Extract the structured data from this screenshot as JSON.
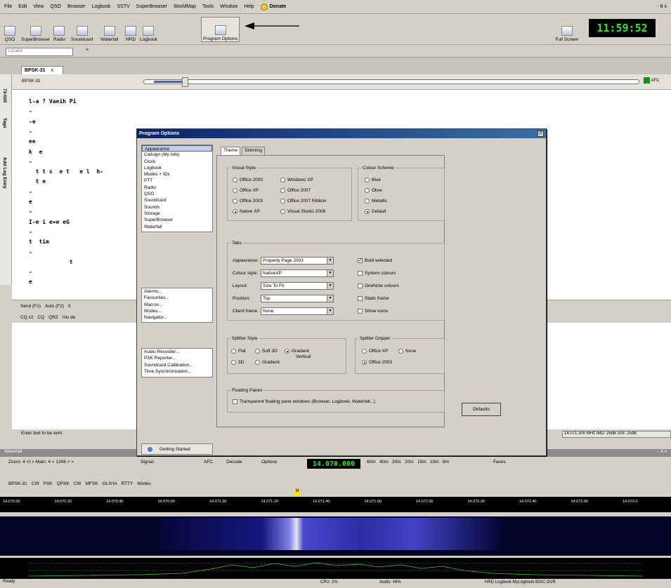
{
  "menubar": {
    "items": [
      "File",
      "Edit",
      "View",
      "QSO",
      "Browser",
      "Logbook",
      "SSTV",
      "SuperBrowser",
      "WorldMap",
      "Tools",
      "Window",
      "Help"
    ],
    "donate": "Donate",
    "window_controls": "- 8 x"
  },
  "toolbar": {
    "buttons": [
      "QSO",
      "SuperBrowser",
      "Radio",
      "Soundcard",
      "Waterfall",
      "HRD",
      "Logbook",
      "Program Options"
    ],
    "fullscreen": "Full Screen",
    "clock": "11:59:52"
  },
  "locator": {
    "placeholder": "Locator",
    "arrow": ">"
  },
  "doc_tab": {
    "label": "BPSK-31",
    "close": "x"
  },
  "side_tabs": [
    "73-020",
    "Tags",
    "Add Log Entry"
  ],
  "inner_toolbar": {
    "mode": "BPSK-31",
    "afc": "AFC"
  },
  "rx_lines": [
    "l-a ? Vaeih Pi",
    "-",
    "-e",
    "-",
    "ee",
    "k  e",
    "-",
    "  t t s  e t   e l  h-",
    "  t e",
    "-",
    "e",
    "-",
    "I-e i e=e eG",
    "-",
    "t  tim",
    "-",
    "            t",
    "-",
    "e"
  ],
  "tx": {
    "buttons": [
      "Send (F1)",
      "Auto (F2)",
      "II"
    ],
    "macros": [
      "CQ x2",
      "CQ",
      "QRZ",
      "His de"
    ],
    "hint": "Enter text to be sent",
    "freq_info": "14.071.300 MHz IMD: 26dB S/N: 25dB"
  },
  "dialog": {
    "title": "Program Options",
    "close": "X",
    "nav_group1": [
      "Appearance",
      "Callsign (My Info)",
      "Clock",
      "Logbook",
      "Modes + IDs",
      "PTT",
      "Radio",
      "QSO",
      "Soundcard",
      "Sounds",
      "Storage",
      "SuperBrowser",
      "Waterfall"
    ],
    "nav_group2": [
      "Alarms...",
      "Favourites...",
      "Macros...",
      "Modes...",
      "Navigator..."
    ],
    "nav_group3": [
      "Audio Recorder...",
      "PSK Reporter...",
      "Soundcard Calibration...",
      "Time Synchronisation..."
    ],
    "getting_started": "Getting Started",
    "tabs": [
      "Theme",
      "Skinning"
    ],
    "visual_style": {
      "legend": "Visual Style",
      "options": [
        "Office 2000",
        "Windows XP",
        "Office XP",
        "Office 2007",
        "Office 2003",
        "Office 2007 Ribbon",
        "Native XP",
        "Visual Studio 2008"
      ],
      "selected": "Native XP"
    },
    "colour_scheme": {
      "legend": "Colour Scheme",
      "options": [
        "Blue",
        "Olive",
        "Metallic",
        "Default"
      ],
      "selected": "Default"
    },
    "tabs_group": {
      "legend": "Tabs",
      "appearance_label": "Appearance:",
      "appearance_value": "Property Page 2003",
      "colour_style_label": "Colour style:",
      "colour_style_value": "NativeXP",
      "layout_label": "Layout:",
      "layout_value": "Size To Fit",
      "position_label": "Position:",
      "position_value": "Top",
      "client_frame_label": "Client frame:",
      "client_frame_value": "None",
      "checks": [
        "Bold selected",
        "System colours",
        "OneNote colours",
        "Static frame",
        "Show icons"
      ],
      "checked": [
        "Bold selected"
      ]
    },
    "splitter_style": {
      "legend": "Splitter Style",
      "options": [
        "Flat",
        "Soft 3D",
        "Gradient",
        "3D",
        "Gradient",
        "Vertical"
      ],
      "selected": "Gradient"
    },
    "splitter_gripper": {
      "legend": "Splitter Gripper",
      "options": [
        "Office XP",
        "None",
        "Office 2003"
      ],
      "selected": "Office 2003"
    },
    "floating_panes": {
      "legend": "Floating Panes",
      "check": "Transparent floating pane windows (Browser, Logbook, Waterfall...)"
    },
    "defaults_button": "Defaults"
  },
  "waterfall": {
    "header": "Waterfall",
    "header_controls": "- 4 x",
    "zoom": "Zoom: 4 <I > Main: 4 < 1306 > >",
    "signal": "Signal:",
    "afc": "AFC",
    "decode": "Decode",
    "options": "Options",
    "frequency": "14.070.000",
    "bands": [
      "80m",
      "40m",
      "30m",
      "20m",
      "15m",
      "10m",
      "6m"
    ],
    "faves": "Faves",
    "modes": [
      "BPSK-31",
      "CW",
      "PSK",
      "QPSK",
      "CW",
      "MFSK",
      "OLIVIA",
      "RTTY",
      "Modes"
    ],
    "scale": [
      "14.070.00",
      "14.070.20",
      "14.070.40",
      "14.070.60",
      "14.071.00",
      "14.071.20",
      "14.071.40",
      "14.071.60",
      "14.072.00",
      "14.072.20",
      "14.072.40",
      "14.072.60",
      "14.073.0"
    ],
    "marker": "M"
  },
  "status": {
    "ready": "Ready",
    "cpu": "CPU: 2%",
    "audio": "Audio: 49%",
    "right": "HRD Logbook MyLogbook BSIC OVR"
  },
  "colors": {
    "clock_bg": "#000000",
    "clock_fg": "#2ee62e",
    "title_bar": "#0a246a",
    "waterfall_signal": "#4a4aff"
  }
}
